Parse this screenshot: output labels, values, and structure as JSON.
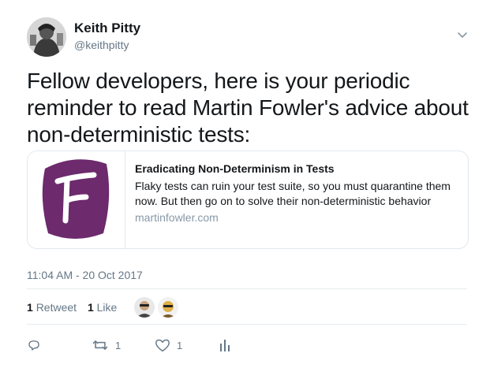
{
  "author": {
    "name": "Keith Pitty",
    "handle": "@keithpitty"
  },
  "tweet": {
    "text": "Fellow developers, here is your periodic reminder to read Martin Fowler's advice about non-deterministic tests:",
    "timestamp": "11:04 AM - 20 Oct 2017"
  },
  "card": {
    "title": "Eradicating Non-Determinism in Tests",
    "description": "Flaky tests can ruin your test suite, so you must quarantine them now. But then go on to solve their non-deterministic behavior",
    "domain": "martinfowler.com",
    "logo_color": "#6d2a6d"
  },
  "stats": {
    "retweets_count": "1",
    "retweets_label": "Retweet",
    "likes_count": "1",
    "likes_label": "Like"
  },
  "actions": {
    "reply_count": "",
    "retweet_count": "1",
    "like_count": "1"
  },
  "icons": [
    "chevron-down-icon",
    "reply-icon",
    "retweet-icon",
    "heart-icon",
    "analytics-icon"
  ],
  "colors": {
    "text": "#14171a",
    "secondary": "#657786",
    "border": "#e1e8ed"
  }
}
